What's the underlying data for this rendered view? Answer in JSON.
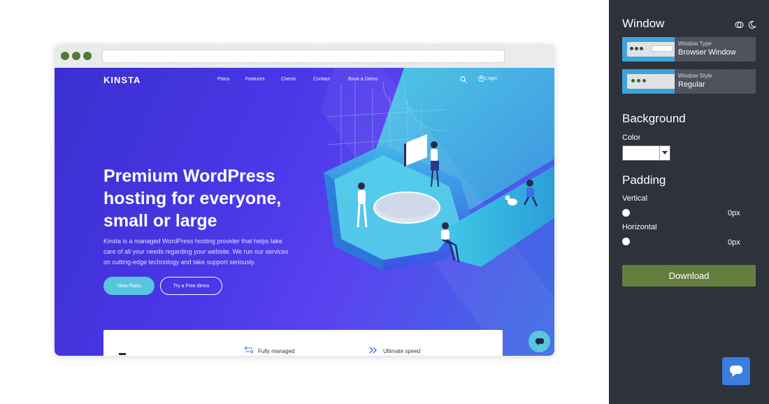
{
  "site": {
    "logo": "KINSTA",
    "nav": [
      "Plans",
      "Features",
      "Clients",
      "Contact",
      "Book a Demo"
    ],
    "login": "Login",
    "hero_title": [
      "Premium WordPress",
      "hosting for everyone,",
      "small or large"
    ],
    "hero_text": [
      "Kinsta is a managed WordPress hosting provider that helps take",
      "care of all your needs regarding your website. We run our services",
      "on cutting-edge technology and take support seriously."
    ],
    "primary_button": "View Plans",
    "secondary_button": "Try a Free demo",
    "features": [
      "Fully managed",
      "Ultimate speed"
    ]
  },
  "panel": {
    "window_heading": "Window",
    "window_type": {
      "label": "Window Type",
      "value": "Browser Window"
    },
    "window_style": {
      "label": "Window Style",
      "value": "Regular"
    },
    "background_heading": "Background",
    "color_label": "Color",
    "color_value": "#ffffff",
    "padding_heading": "Padding",
    "vertical_label": "Vertical",
    "vertical_value": "0px",
    "horizontal_label": "Horizontal",
    "horizontal_value": "0px",
    "download_label": "Download"
  },
  "colors": {
    "panel_bg": "#2d323b",
    "download_bg": "#657e3f",
    "hero_blue": "#4a38e8",
    "accent_cyan": "#58c5e0",
    "window_dot": "#517a39",
    "help_button": "#3b7de0"
  },
  "icons": [
    "search-icon",
    "user-icon",
    "chat-icon",
    "settings-toggle-icon",
    "moon-icon",
    "dropdown-arrow-icon",
    "help-chat-icon"
  ]
}
